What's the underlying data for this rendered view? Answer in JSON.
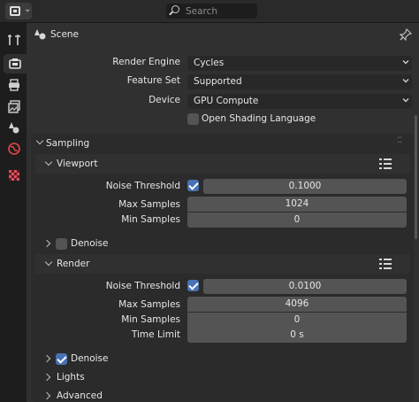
{
  "topbar": {
    "search_placeholder": "Search",
    "editor_type_icon": "properties-editor-icon"
  },
  "tabs": [
    {
      "name": "tool",
      "icon": "wrench-screwdriver-icon",
      "active": false
    },
    {
      "name": "render",
      "icon": "camera-back-icon",
      "active": true
    },
    {
      "name": "output",
      "icon": "printer-icon",
      "active": false
    },
    {
      "name": "view-layer",
      "icon": "image-stack-icon",
      "active": false
    },
    {
      "name": "scene",
      "icon": "scene-cone-sphere-icon",
      "active": false
    },
    {
      "name": "world",
      "icon": "world-globe-icon",
      "active": false
    },
    {
      "name": "texture",
      "icon": "checker-texture-icon",
      "active": false
    }
  ],
  "header": {
    "context_label": "Scene",
    "pin_icon": "pin-icon"
  },
  "render_settings": {
    "render_engine": {
      "label": "Render Engine",
      "value": "Cycles"
    },
    "feature_set": {
      "label": "Feature Set",
      "value": "Supported"
    },
    "device": {
      "label": "Device",
      "value": "GPU Compute"
    },
    "open_shading_language": {
      "label": "Open Shading Language",
      "checked": false
    }
  },
  "sampling": {
    "title": "Sampling",
    "viewport": {
      "title": "Viewport",
      "noise_threshold": {
        "label": "Noise Threshold",
        "checked": true,
        "value": "0.1000"
      },
      "max_samples": {
        "label": "Max Samples",
        "value": "1024"
      },
      "min_samples": {
        "label": "Min Samples",
        "value": "0"
      },
      "denoise": {
        "label": "Denoise",
        "checked": false
      }
    },
    "render": {
      "title": "Render",
      "noise_threshold": {
        "label": "Noise Threshold",
        "checked": true,
        "value": "0.0100"
      },
      "max_samples": {
        "label": "Max Samples",
        "value": "4096"
      },
      "min_samples": {
        "label": "Min Samples",
        "value": "0"
      },
      "time_limit": {
        "label": "Time Limit",
        "value": "0 s"
      },
      "denoise": {
        "label": "Denoise",
        "checked": true
      }
    },
    "lights": {
      "title": "Lights"
    },
    "advanced": {
      "title": "Advanced"
    }
  },
  "colors": {
    "accent_checkbox": "#4772b3",
    "panel_bg": "#303030",
    "field_bg": "#545454"
  }
}
